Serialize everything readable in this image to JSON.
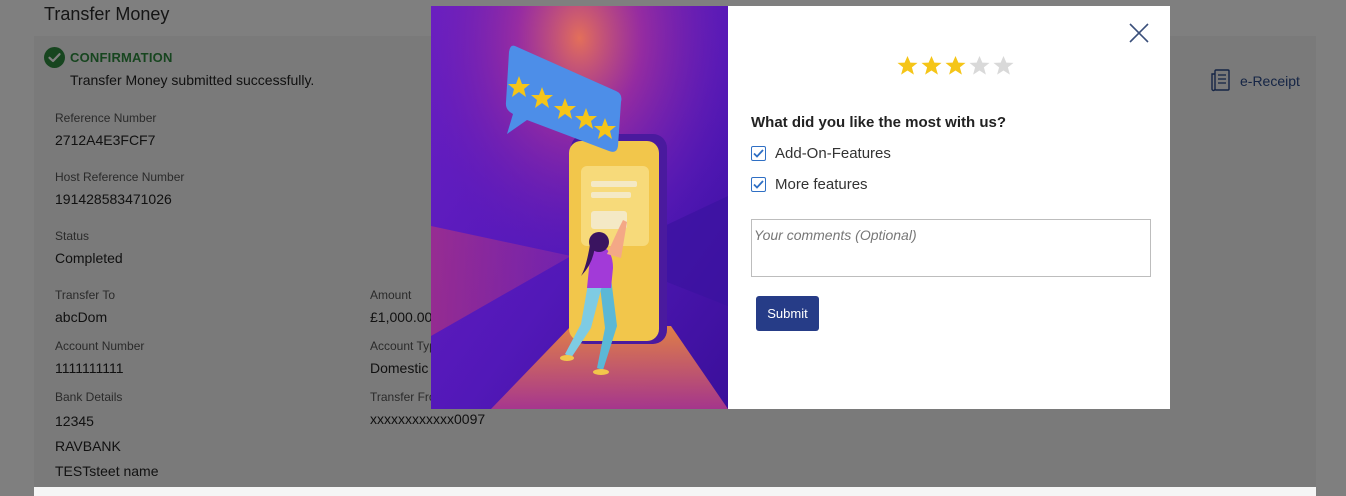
{
  "page": {
    "title": "Transfer Money",
    "confirmation_title": "CONFIRMATION",
    "confirmation_message": "Transfer Money submitted successfully.",
    "ereceipt_label": "e-Receipt"
  },
  "details": {
    "reference_number_label": "Reference Number",
    "reference_number": "2712A4E3FCF7",
    "host_reference_label": "Host Reference Number",
    "host_reference": "191428583471026",
    "status_label": "Status",
    "status": "Completed",
    "transfer_to_label": "Transfer To",
    "transfer_to": "abcDom",
    "amount_label": "Amount",
    "amount": "£1,000.00",
    "account_number_label": "Account Number",
    "account_number": "1111111111",
    "account_type_label": "Account Type",
    "account_type": "Domestic",
    "bank_details_label": "Bank Details",
    "bank_code": "12345",
    "bank_name": "RAVBANK",
    "bank_address": "TESTsteet name",
    "transfer_from_label": "Transfer From",
    "transfer_from": "xxxxxxxxxxxx0097"
  },
  "feedback": {
    "rating": 3,
    "max_rating": 5,
    "question": "What did you like the most with us?",
    "options": [
      {
        "label": "Add-On-Features",
        "checked": true
      },
      {
        "label": "More features",
        "checked": true
      }
    ],
    "comments_placeholder": "Your comments (Optional)",
    "comments_value": "",
    "submit_label": "Submit"
  },
  "colors": {
    "star_filled": "#f5c518",
    "star_empty": "#d9d9d9",
    "submit_bg": "#263c87",
    "checkbox": "#2f6fc4",
    "success": "#2e8b3e"
  },
  "icons": [
    "check-circle-icon",
    "receipt-icon",
    "close-icon",
    "star-icon",
    "checkbox-checked-icon"
  ]
}
